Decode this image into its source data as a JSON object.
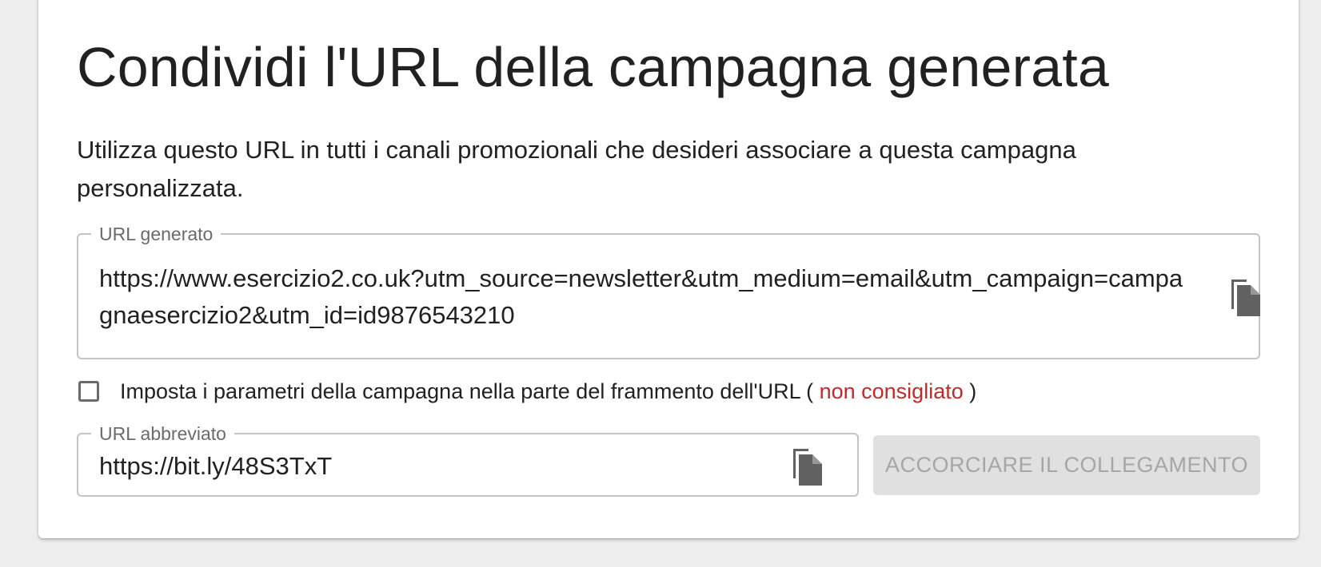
{
  "page": {
    "title": "Condividi l'URL della campagna generata",
    "description": "Utilizza questo URL in tutti i canali promozionali che desideri associare a questa campagna personalizzata."
  },
  "generated_url": {
    "label": "URL generato",
    "value": "https://www.esercizio2.co.uk?utm_source=newsletter&utm_medium=email&utm_campaign=campagnaesercizio2&utm_id=id9876543210",
    "copy_icon": "copy-icon"
  },
  "fragment_option": {
    "checked": false,
    "label_prefix": "Imposta i parametri della campagna nella parte del frammento dell'URL (",
    "warning": "non consigliato",
    "label_suffix": ")"
  },
  "short_url": {
    "label": "URL abbreviato",
    "value": "https://bit.ly/48S3TxT",
    "copy_icon": "copy-icon",
    "shorten_button": "ACCORCIARE IL COLLEGAMENTO"
  },
  "colors": {
    "warning": "#c62828",
    "disabled_button_bg": "#e0e0e0",
    "disabled_button_text": "#a6a6a6",
    "icon": "#616161"
  }
}
